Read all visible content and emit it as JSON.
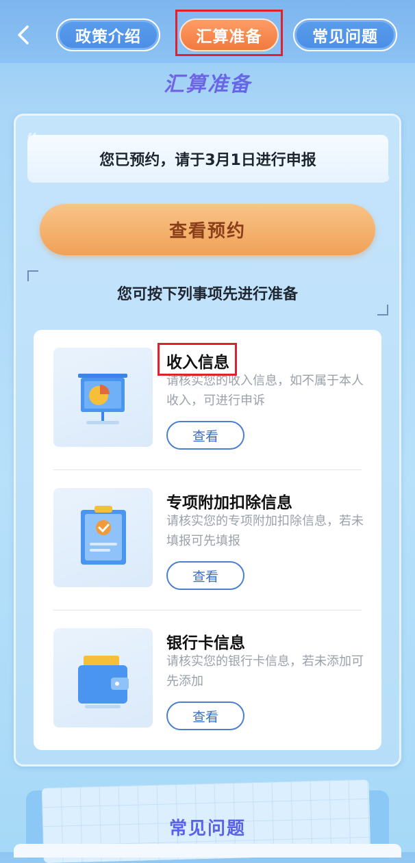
{
  "nav": {
    "back_icon": "chevron-left-icon",
    "tabs": [
      {
        "label": "政策介绍",
        "active": false
      },
      {
        "label": "汇算准备",
        "active": true
      },
      {
        "label": "常见问题",
        "active": false
      }
    ]
  },
  "section_title": "汇算准备",
  "notice": "您已预约，请于3月1日进行申报",
  "view_appointment_label": "查看预约",
  "prep_hint": "您可按下列事项先进行准备",
  "items": [
    {
      "title": "收入信息",
      "desc": "请核实您的收入信息，如不属于本人收入，可进行申诉",
      "button": "查看",
      "icon": "presentation-chart-icon"
    },
    {
      "title": "专项附加扣除信息",
      "desc": "请核实您的专项附加扣除信息，若未填报可先填报",
      "button": "查看",
      "icon": "clipboard-check-icon"
    },
    {
      "title": "银行卡信息",
      "desc": "请核实您的银行卡信息，若未添加可先添加",
      "button": "查看",
      "icon": "wallet-icon"
    }
  ],
  "faq_title": "常见问题",
  "colors": {
    "active_tab": "#f07a3e",
    "inactive_tab": "#4a8ee6",
    "highlight_box": "#e0202c",
    "button_border": "#4a7fd0"
  }
}
